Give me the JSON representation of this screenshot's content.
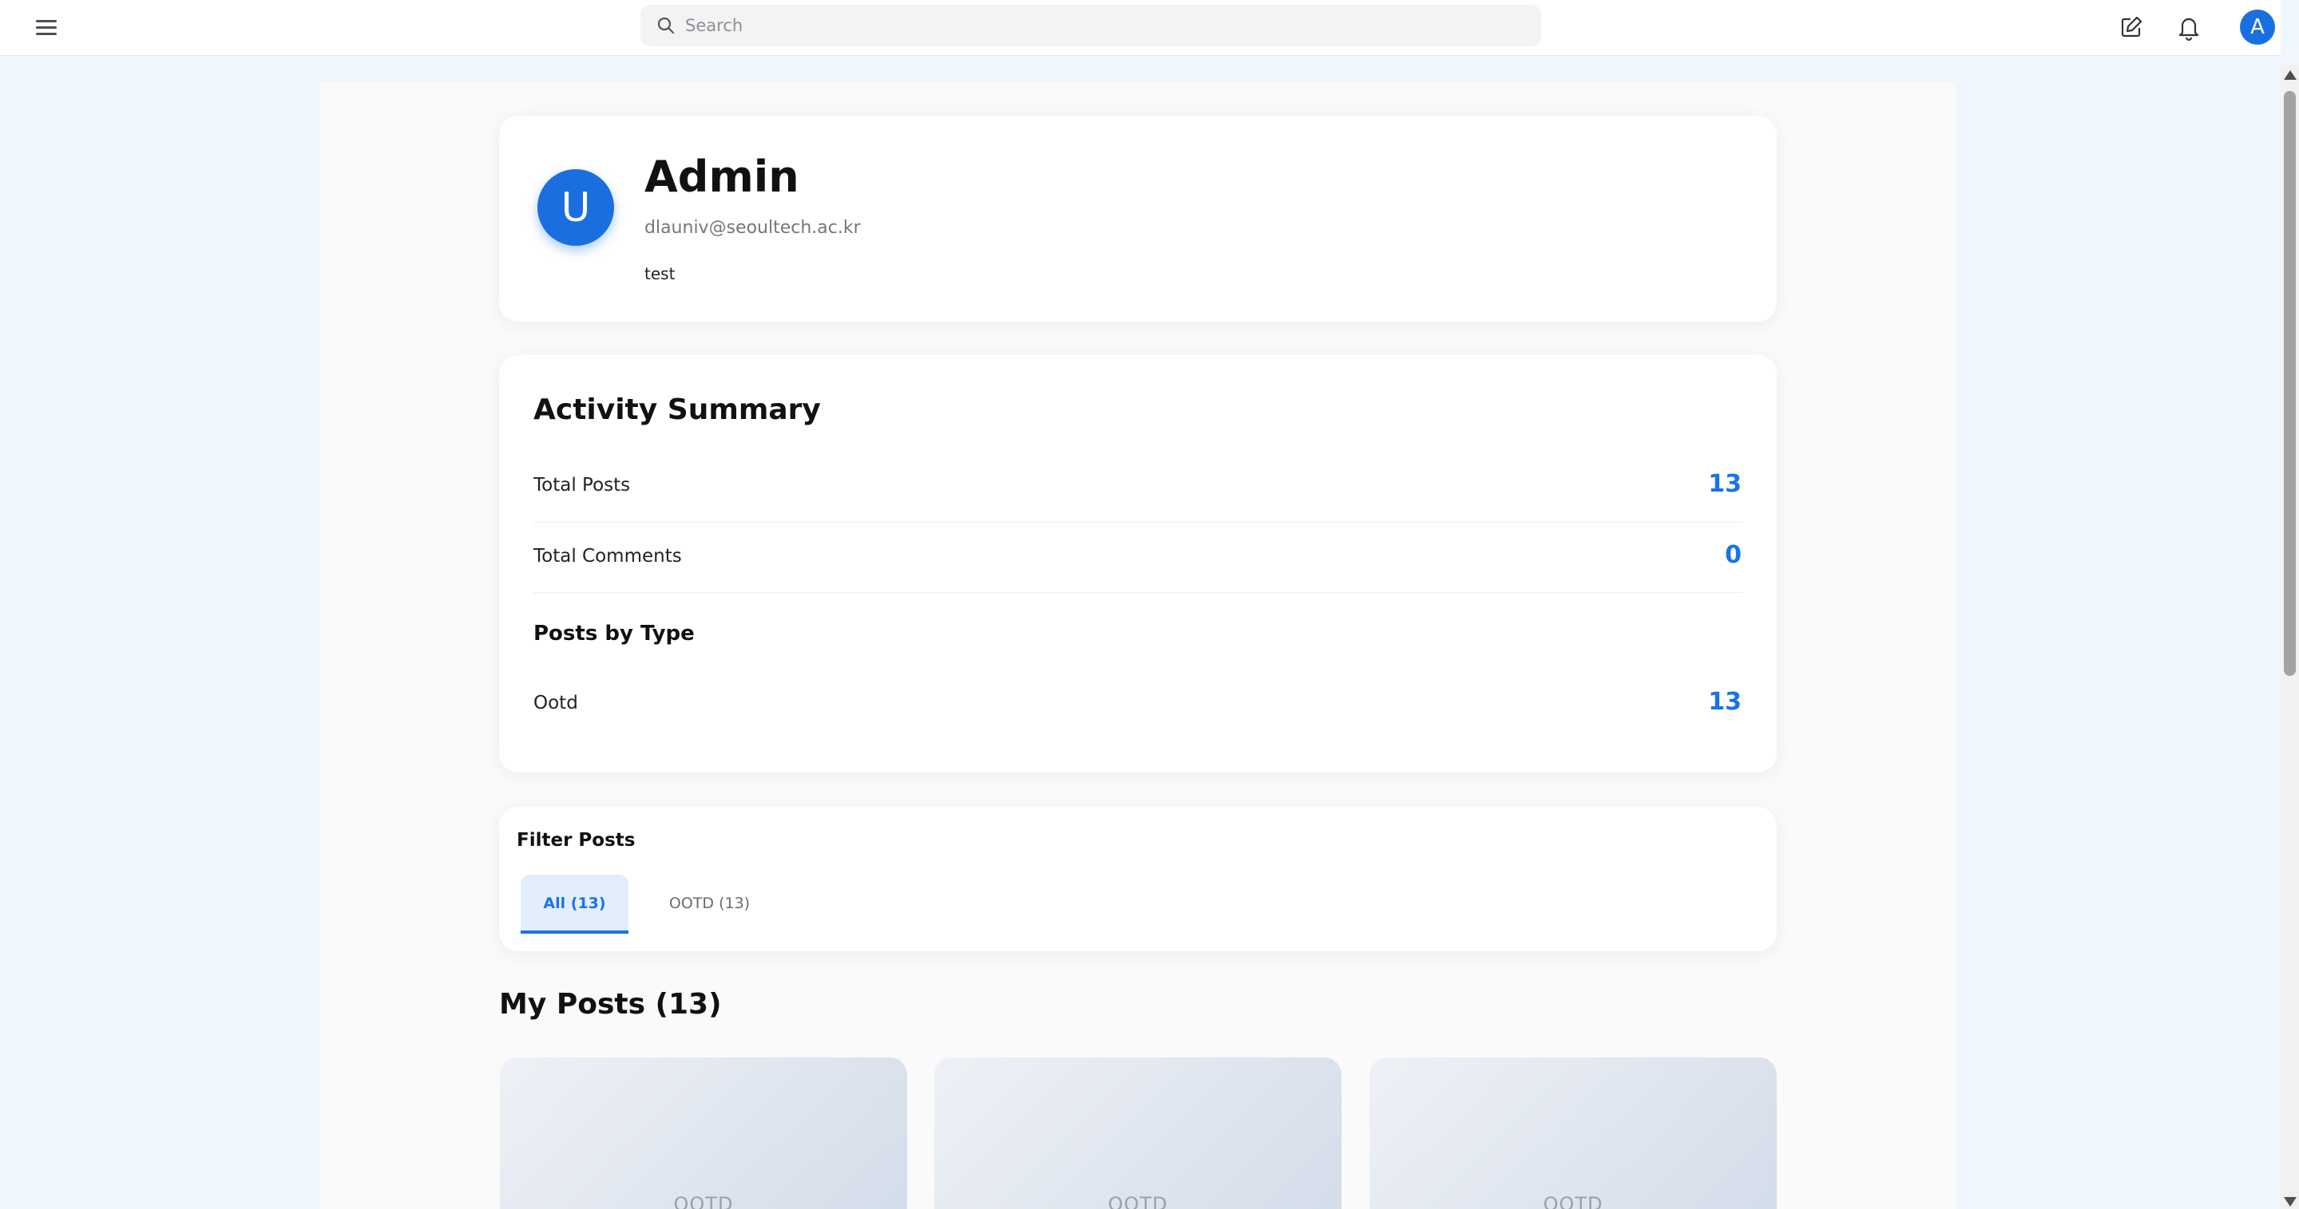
{
  "topbar": {
    "search_placeholder": "Search",
    "menu_icon": "menu-icon",
    "compose_icon": "edit-icon",
    "bell_icon": "bell-icon",
    "user_initial": "A"
  },
  "profile": {
    "avatar_initial": "U",
    "name": "Admin",
    "email": "dlauniv@seoultech.ac.kr",
    "bio": "test"
  },
  "activity": {
    "title": "Activity Summary",
    "rows": [
      {
        "label": "Total Posts",
        "value": "13"
      },
      {
        "label": "Total Comments",
        "value": "0"
      }
    ],
    "by_type_title": "Posts by Type",
    "types": [
      {
        "label": "Ootd",
        "value": "13"
      }
    ]
  },
  "filter": {
    "title": "Filter Posts",
    "tabs": [
      {
        "label": "All (13)",
        "active": true
      },
      {
        "label": "OOTD (13)",
        "active": false
      }
    ]
  },
  "posts": {
    "heading": "My Posts (13)",
    "cards": [
      {
        "label": "OOTD"
      },
      {
        "label": "OOTD"
      },
      {
        "label": "OOTD"
      }
    ]
  },
  "colors": {
    "accent": "#1a73e8",
    "avatar": "#1a6fe0",
    "page_bg": "#eff6fd"
  }
}
